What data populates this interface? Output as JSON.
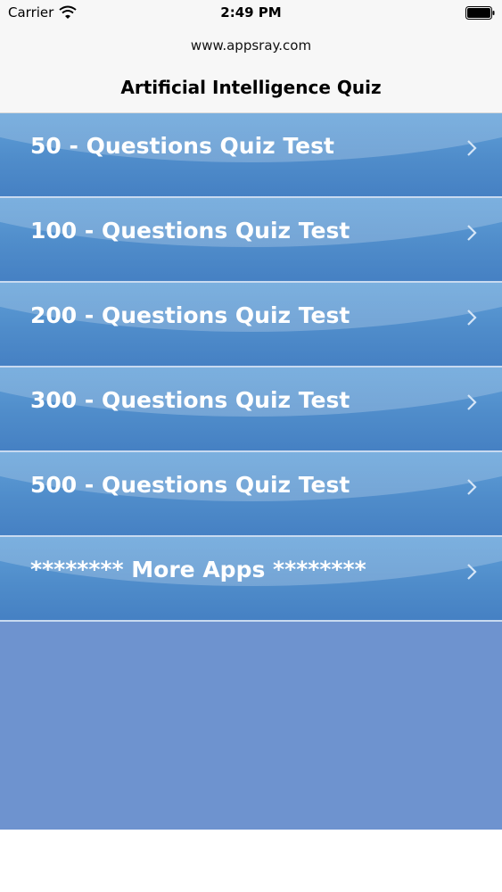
{
  "status_bar": {
    "carrier": "Carrier",
    "time": "2:49 PM"
  },
  "nav": {
    "subtitle": "www.appsray.com",
    "title": "Artificial Intelligence Quiz"
  },
  "menu": {
    "items": [
      {
        "label": "50 - Questions Quiz Test"
      },
      {
        "label": "100 - Questions Quiz Test"
      },
      {
        "label": "200 - Questions Quiz Test"
      },
      {
        "label": "300 - Questions Quiz Test"
      },
      {
        "label": "500 - Questions Quiz Test"
      },
      {
        "label": "******** More Apps ********"
      }
    ]
  },
  "colors": {
    "row_top": "#5f9fd8",
    "row_bottom": "#4580c3",
    "list_background": "#6e93cf",
    "divider": "#c8daf0"
  }
}
